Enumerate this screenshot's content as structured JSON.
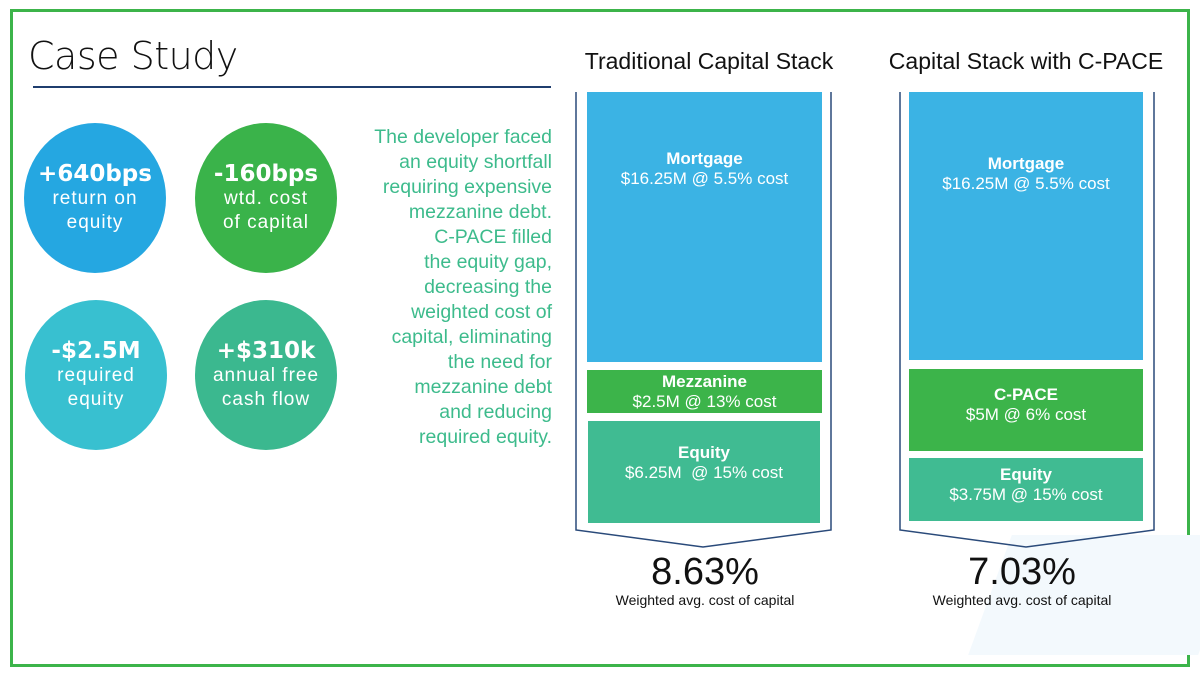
{
  "title": "Case Study",
  "stats": [
    {
      "value": "+640bps",
      "label_lines": [
        "return on",
        "equity"
      ],
      "color": "#25a7e1"
    },
    {
      "value": "-160bps",
      "label_lines": [
        "wtd. cost",
        "of capital"
      ],
      "color": "#3ab34a"
    },
    {
      "value": "-$2.5M",
      "label_lines": [
        "required",
        "equity"
      ],
      "color": "#38c0d0"
    },
    {
      "value": "+$310k",
      "label_lines": [
        "annual free",
        "cash flow"
      ],
      "color": "#3bb88f"
    }
  ],
  "description_lines": [
    "The developer faced",
    "an equity shortfall",
    "requiring expensive",
    "mezzanine debt.",
    "C-PACE filled",
    "the equity gap,",
    "decreasing the",
    "weighted cost of",
    "capital, eliminating",
    "the need for",
    "mezzanine debt",
    "and reducing",
    "required equity."
  ],
  "stacks": [
    {
      "title": "Traditional Capital Stack",
      "layers": [
        {
          "name": "Mortgage",
          "detail": "$16.25M @ 5.5% cost",
          "color": "#3bb3e4"
        },
        {
          "name": "Mezzanine",
          "detail": "$2.5M @ 13% cost",
          "color": "#3cb44a"
        },
        {
          "name": "Equity",
          "detail": "$6.25M  @ 15% cost",
          "color": "#40bb92"
        }
      ],
      "wacc": "8.63%",
      "wacc_label": "Weighted avg. cost of capital"
    },
    {
      "title": "Capital Stack with C-PACE",
      "layers": [
        {
          "name": "Mortgage",
          "detail": "$16.25M @ 5.5% cost",
          "color": "#3bb3e4"
        },
        {
          "name": "C-PACE",
          "detail": "$5M @ 6% cost",
          "color": "#3cb44a"
        },
        {
          "name": "Equity",
          "detail": "$3.75M @ 15% cost",
          "color": "#40bb92"
        }
      ],
      "wacc": "7.03%",
      "wacc_label": "Weighted avg. cost of capital"
    }
  ],
  "colors": {
    "frame": "#3cb44a",
    "rule": "#1f3d6e",
    "outline": "#2a4a7a",
    "description": "#3dbb8c"
  }
}
